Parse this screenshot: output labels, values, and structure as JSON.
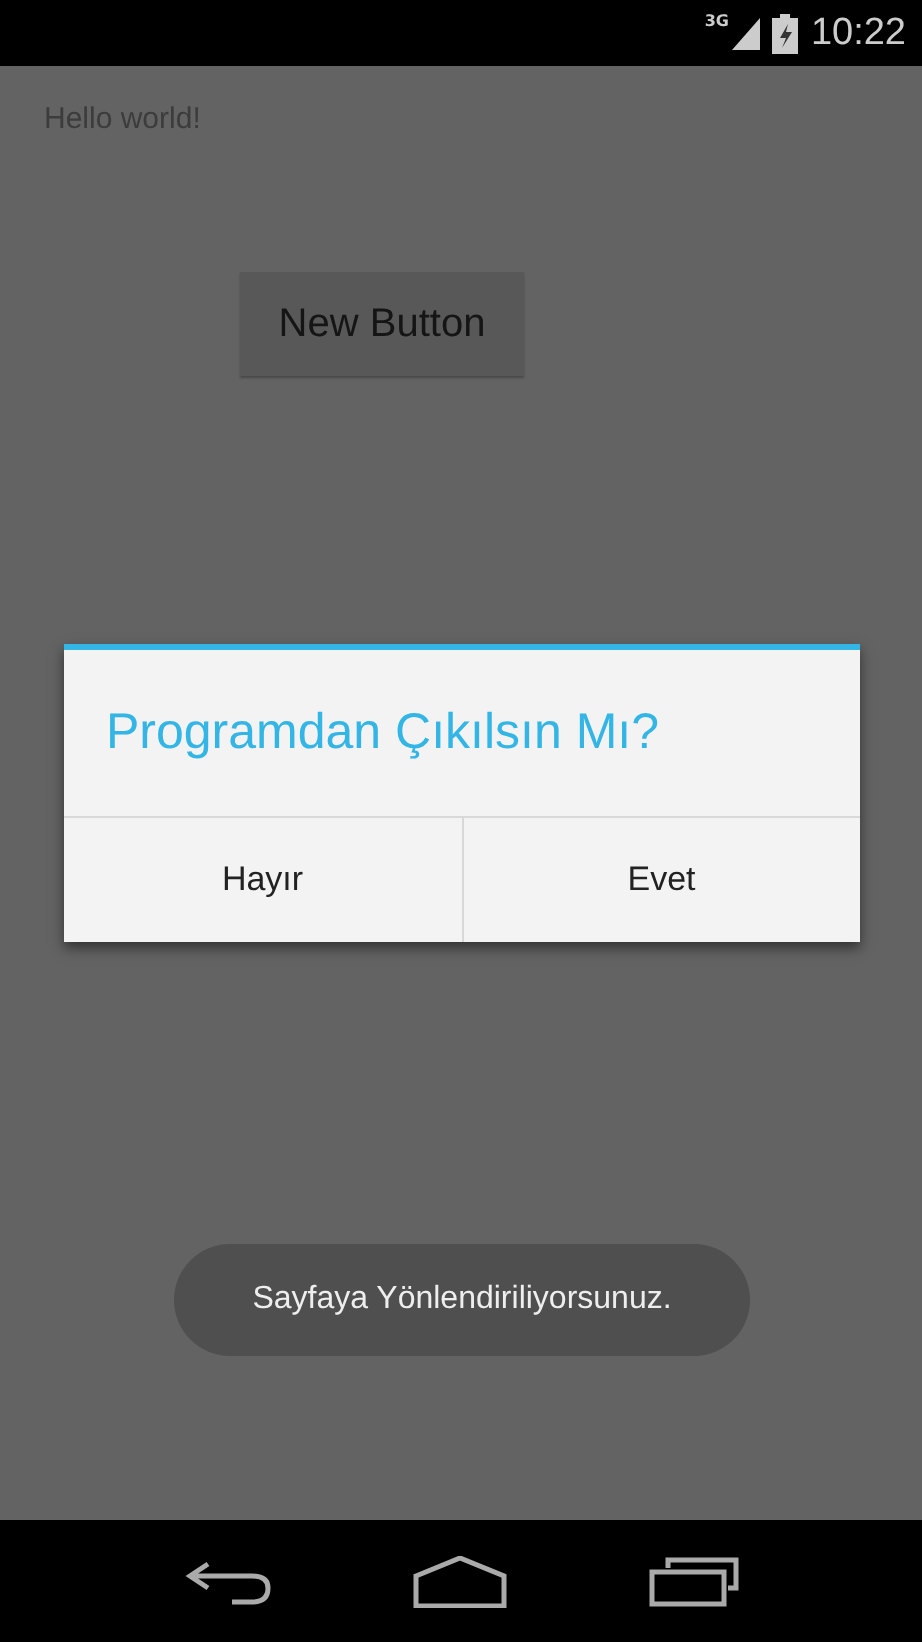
{
  "status_bar": {
    "network": "3G",
    "time": "10:22"
  },
  "app": {
    "greeting": "Hello world!",
    "button": "New Button"
  },
  "dialog": {
    "title": "Programdan Çıkılsın Mı?",
    "buttons": [
      "Hayır",
      "Evet"
    ]
  },
  "toast": {
    "text": "Sayfaya Yönlendiriliyorsunuz."
  }
}
